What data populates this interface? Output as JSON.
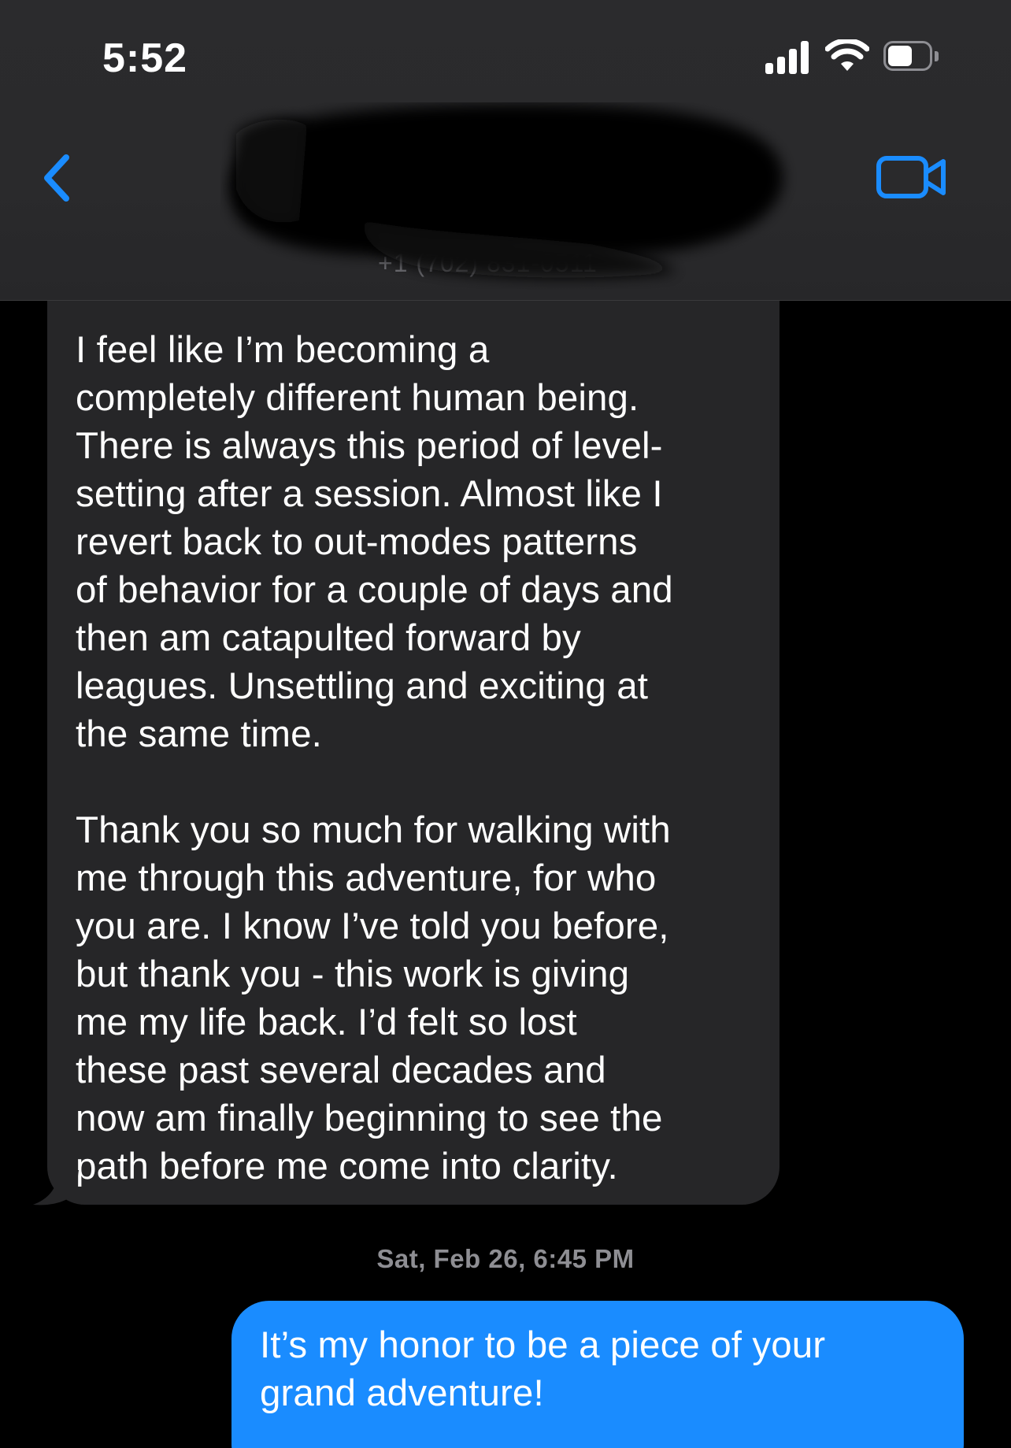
{
  "status_bar": {
    "time": "5:52",
    "signal_bars": 4,
    "wifi": "connected",
    "battery_level": 0.5
  },
  "header": {
    "back_icon": "chevron-left-icon",
    "contact_phone": "+1 (702) 831-0511",
    "contact_name_redacted": true,
    "video_icon": "video-camera-icon",
    "accent_color": "#1a8cff"
  },
  "messages": [
    {
      "direction": "incoming",
      "text": "I feel like I’m becoming a\ncompletely different human being.\nThere is always this period of level-\nsetting after a session.  Almost like I\nrevert back to out-modes patterns\nof behavior for a couple of days and\nthen am catapulted forward by\nleagues.  Unsettling and exciting at\nthe same time.\n\nThank you so much for walking with\nme through this adventure, for who\nyou are.  I know I’ve told you before,\nbut thank you - this work is giving\nme my life back.  I’d felt so lost\nthese past several decades and\nnow am finally beginning to see the\npath before me come into clarity.",
      "bubble_color": "#262628"
    },
    {
      "direction": "timestamp",
      "text": "Sat, Feb 26, 6:45 PM"
    },
    {
      "direction": "outgoing",
      "text": "It’s my honor to be a piece of your\ngrand adventure!",
      "bubble_color": "#1a8cff"
    }
  ]
}
